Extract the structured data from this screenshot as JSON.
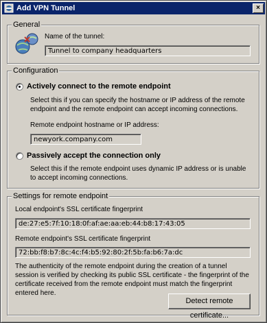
{
  "window": {
    "title": "Add VPN Tunnel",
    "close_glyph": "×"
  },
  "general": {
    "legend": "General",
    "name_label": "Name of the tunnel:",
    "name_value": "Tunnel to company headquarters"
  },
  "configuration": {
    "legend": "Configuration",
    "active_option": {
      "label": "Actively connect to the remote endpoint",
      "selected": true,
      "description": "Select this if you can specify the hostname or IP address of the remote endpoint and the remote endpoint can accept incoming connections."
    },
    "host_label": "Remote endpoint hostname or IP address:",
    "host_value": "newyork.company.com",
    "passive_option": {
      "label": "Passively accept the connection only",
      "selected": false,
      "description": "Select this if the remote endpoint uses dynamic IP address or is unable to accept incoming connections."
    }
  },
  "remote_settings": {
    "legend": "Settings for remote endpoint",
    "local_fp_label": "Local endpoint's SSL certificate fingerprint",
    "local_fp_value": "de:27:e5:7f:10:18:0f:af:ae:aa:eb:44:b8:17:43:05",
    "remote_fp_label": "Remote endpoint's SSL certificate fingerprint",
    "remote_fp_value": "72:bb:f8:b7:8c:4c:f4:b5:92:80:2f:5b:fa:b6:7a:dc",
    "note": "The authenticity of the remote endpoint during the creation of a tunnel session is verified by checking its public SSL certificate - the fingerprint of the certificate received from the remote endpoint must match the fingerprint entered here.",
    "detect_button": "Detect remote certificate..."
  },
  "icons": {
    "app": "network-tunnel-icon",
    "general": "vpn-globe-icon"
  }
}
